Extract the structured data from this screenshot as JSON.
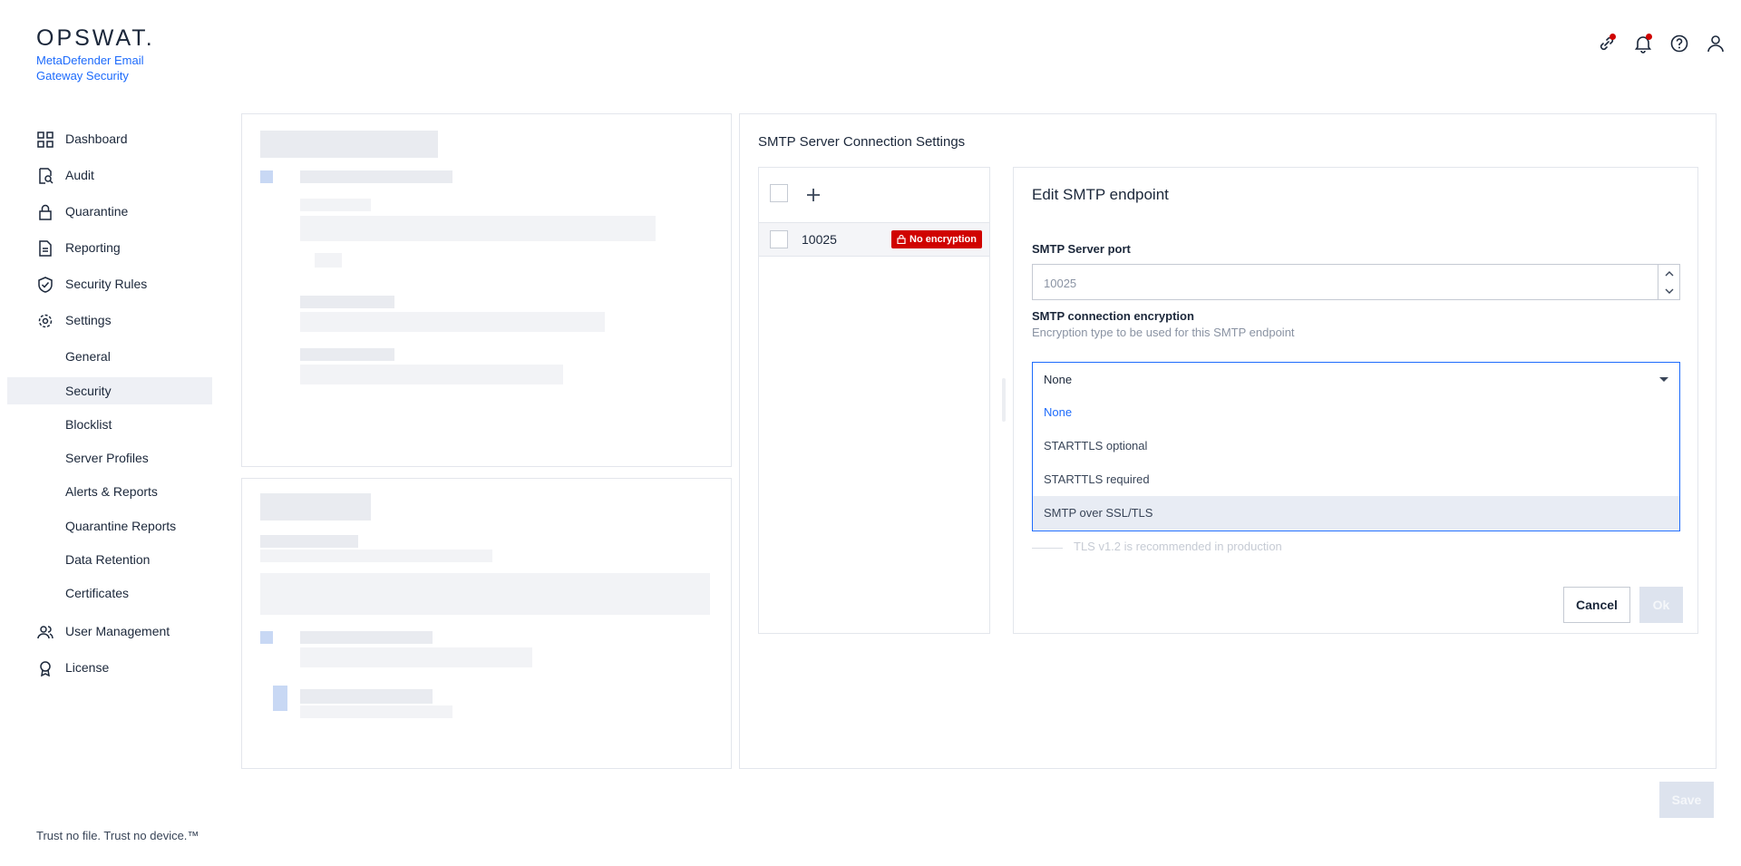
{
  "brand": {
    "logo": "OPSWAT.",
    "product": "MetaDefender Email Gateway Security",
    "tagline": "Trust no file. Trust no device.™"
  },
  "sidebar": {
    "items": [
      {
        "label": "Dashboard",
        "icon": "grid-icon"
      },
      {
        "label": "Audit",
        "icon": "audit-icon"
      },
      {
        "label": "Quarantine",
        "icon": "lock-icon"
      },
      {
        "label": "Reporting",
        "icon": "document-icon"
      },
      {
        "label": "Security Rules",
        "icon": "shield-check-icon"
      },
      {
        "label": "Settings",
        "icon": "gear-icon"
      }
    ],
    "settings_sub": [
      {
        "label": "General"
      },
      {
        "label": "Security",
        "active": true
      },
      {
        "label": "Blocklist"
      },
      {
        "label": "Server Profiles"
      },
      {
        "label": "Alerts & Reports"
      },
      {
        "label": "Quarantine Reports"
      },
      {
        "label": "Data Retention"
      },
      {
        "label": "Certificates"
      }
    ],
    "bottom_items": [
      {
        "label": "User Management",
        "icon": "users-icon"
      },
      {
        "label": "License",
        "icon": "award-icon"
      }
    ]
  },
  "topbar": {
    "icons": [
      "link-icon",
      "bell-icon",
      "help-icon",
      "user-icon"
    ],
    "notification_color": "#d00300"
  },
  "smtp": {
    "title": "SMTP Server Connection Settings",
    "endpoints": [
      {
        "port": "10025",
        "badge": "No encryption"
      }
    ],
    "edit": {
      "title": "Edit SMTP endpoint",
      "port_label": "SMTP Server port",
      "port_value": "10025",
      "encryption_label": "SMTP connection encryption",
      "encryption_hint": "Encryption type to be used for this SMTP endpoint",
      "encryption_selected": "None",
      "encryption_options": [
        "None",
        "STARTTLS optional",
        "STARTTLS required",
        "SMTP over SSL/TLS"
      ],
      "tls_hint": "TLS v1.2 is recommended in production",
      "cancel": "Cancel",
      "ok": "Ok"
    },
    "save": "Save"
  },
  "colors": {
    "accent": "#1d6bfc",
    "danger": "#d00300",
    "active_bg": "#eef0f5"
  }
}
